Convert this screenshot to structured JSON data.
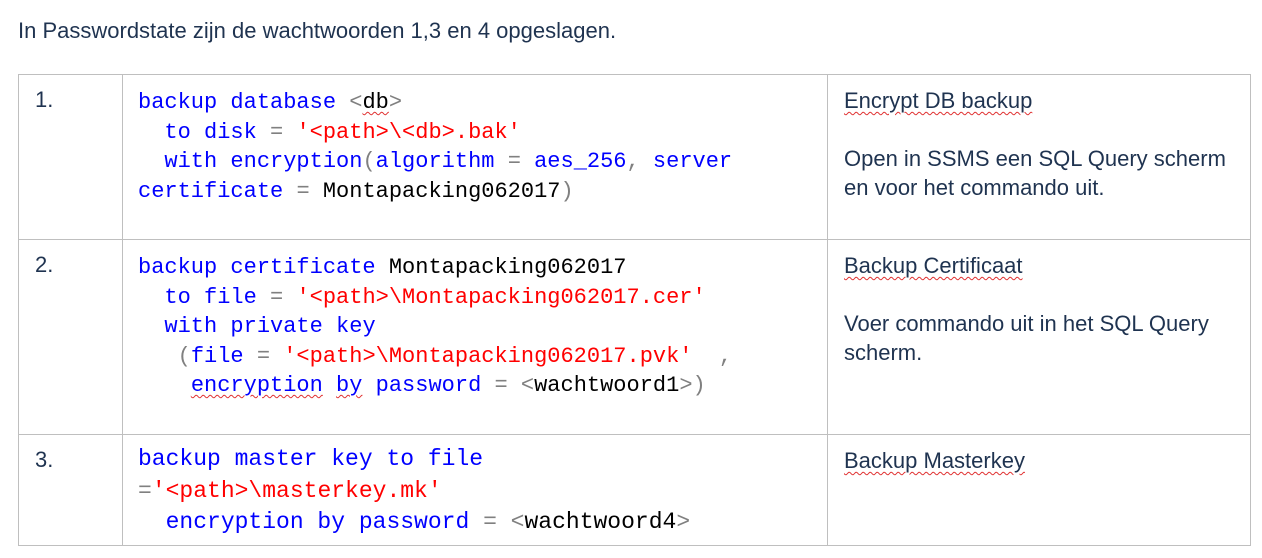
{
  "intro": "In Passwordstate zijn de wachtwoorden 1,3 en 4 opgeslagen.",
  "rows": [
    {
      "number": "1.",
      "code": {
        "l1": {
          "a": "backup database ",
          "b": "<",
          "c": "db",
          "d": ">"
        },
        "l2": {
          "indent": "  ",
          "a": "to disk ",
          "b": "= ",
          "c": "'<path>\\<db>.bak'"
        },
        "l3": {
          "indent": "  ",
          "a": "with encryption",
          "b": "(",
          "c": "algorithm ",
          "d": "= ",
          "e": "aes_256",
          "f": ", ",
          "g": "server"
        },
        "l4": {
          "a": "certificate ",
          "b": "= ",
          "c": "Montapacking062017",
          "d": ")"
        }
      },
      "title": "Encrypt DB backup",
      "description": "Open in SSMS een SQL Query scherm en voor het commando uit."
    },
    {
      "number": "2.",
      "code": {
        "l1": {
          "a": "backup certificate ",
          "b": "Montapacking062017"
        },
        "l2": {
          "indent": "  ",
          "a": "to file ",
          "b": "= ",
          "c": "'<path>\\Montapacking062017.cer'"
        },
        "l3": {
          "indent": "  ",
          "a": "with private key"
        },
        "l4": {
          "indent": "   ",
          "a": "(",
          "b": "file ",
          "c": "= ",
          "d": "'<path>\\Montapacking062017.pvk'",
          "e": "  ,"
        },
        "l5": {
          "indent": "    ",
          "a": "encryption",
          "sp": " ",
          "b": "by",
          "c": " password ",
          "d": "= ",
          "e": "<",
          "f": "wachtwoord1",
          "g": ">)"
        }
      },
      "title": "Backup Certificaat",
      "description": "Voer commando uit in het SQL Query scherm."
    },
    {
      "number": "3.",
      "code": {
        "l1": {
          "a": "backup master key to file"
        },
        "l2": {
          "a": "=",
          "b": "'<path>\\masterkey.mk'"
        },
        "l3": {
          "indent": "  ",
          "a": "encryption by password ",
          "b": "= ",
          "c": "<",
          "d": "wachtwoord4",
          "e": ">"
        }
      },
      "title": "Backup Masterkey",
      "description": ""
    }
  ]
}
